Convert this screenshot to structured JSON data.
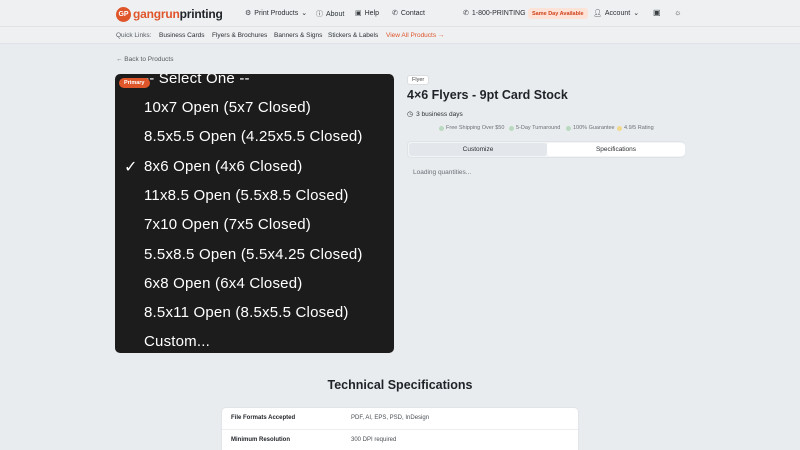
{
  "header": {
    "logo_icon": "GP",
    "logo_text_a": "gangrun",
    "logo_text_b": "printing",
    "nav": [
      {
        "label": "Print Products",
        "icon": "grid-icon",
        "glyph": "⚙",
        "chev": "⌄"
      },
      {
        "label": "About",
        "icon": "info-icon",
        "glyph": "ⓘ"
      },
      {
        "label": "Help",
        "icon": "book-icon",
        "glyph": "▣"
      },
      {
        "label": "Contact",
        "icon": "phone-icon",
        "glyph": "✆"
      }
    ],
    "phone": "1-800-PRINTING",
    "same_day": "Same Day Available",
    "account": "Account",
    "account_chev": "⌄"
  },
  "quick_links": {
    "label": "Quick Links:",
    "items": [
      "Business Cards",
      "Flyers & Brochures",
      "Banners & Signs",
      "Stickers & Labels"
    ],
    "view_all": "View All Products →"
  },
  "back": "← Back to Products",
  "dropdown": {
    "badge": "Primary",
    "options": [
      "-- Select One --",
      "10x7 Open (5x7 Closed)",
      "8.5x5.5 Open (4.25x5.5 Closed)",
      "8x6 Open (4x6 Closed)",
      "11x8.5 Open (5.5x8.5 Closed)",
      "7x10 Open (7x5 Closed)",
      "5.5x8.5 Open (5.5x4.25 Closed)",
      "6x8 Open (6x4 Closed)",
      "8.5x11 Open (8.5x5.5 Closed)",
      "Custom..."
    ],
    "selected_index": 3,
    "checkmark": "✓"
  },
  "product": {
    "tag": "Flyer",
    "title": "4×6 Flyers - 9pt Card Stock",
    "turnaround": "3 business days",
    "features": [
      "Free Shipping Over $50",
      "5-Day Turnaround",
      "100% Guarantee",
      "4.9/5 Rating"
    ],
    "tabs": [
      "Customize",
      "Specifications"
    ],
    "loading": "Loading quantities..."
  },
  "specs": {
    "title": "Technical Specifications",
    "rows": [
      {
        "key": "File Formats Accepted",
        "value": "PDF, AI, EPS, PSD, InDesign"
      },
      {
        "key": "Minimum Resolution",
        "value": "300 DPI required"
      }
    ]
  },
  "colors": {
    "accent": "#e0562b",
    "dropdown_bg": "#1c1c1c"
  }
}
